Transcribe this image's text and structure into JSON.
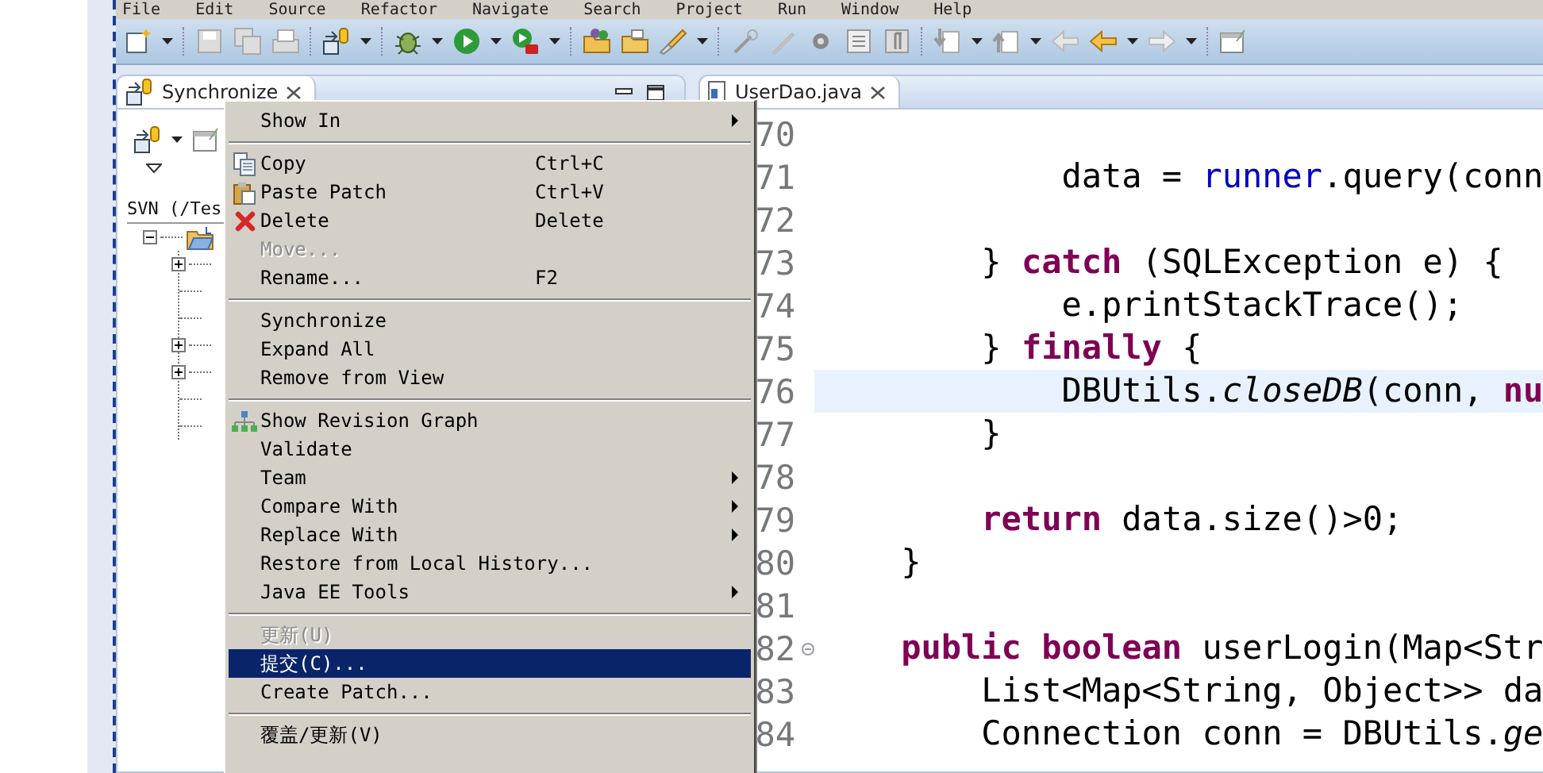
{
  "menu_bar": [
    "File",
    "Edit",
    "Source",
    "Refactor",
    "Navigate",
    "Search",
    "Project",
    "Run",
    "Window",
    "Help"
  ],
  "sync_view": {
    "tab": {
      "label": "Synchronize",
      "selected": true
    },
    "tree_header": "SVN (/Tes",
    "tree": [
      {
        "expanded": true,
        "children": [
          {
            "kind": "folder",
            "expanded": false
          },
          {
            "kind": "leaf"
          },
          {
            "kind": "leaf"
          },
          {
            "kind": "folder",
            "expanded": false
          },
          {
            "kind": "folder",
            "expanded": false
          },
          {
            "kind": "leaf"
          },
          {
            "kind": "leaf"
          }
        ]
      }
    ]
  },
  "editor": {
    "tab": {
      "label": "UserDao.java",
      "selected": true
    },
    "lines": [
      {
        "number": "70"
      },
      {
        "number": "71",
        "current": false,
        "code": [
          {
            "t": "            data = ",
            "kind": "plain"
          },
          {
            "t": "runner",
            "kind": "field"
          },
          {
            "t": ".query(conn",
            "kind": "plain"
          }
        ]
      },
      {
        "number": "72"
      },
      {
        "number": "73",
        "current": false,
        "code": [
          {
            "t": "        } ",
            "kind": "plain"
          },
          {
            "t": "catch",
            "kind": "keyword"
          },
          {
            "t": " (SQLException e) {",
            "kind": "plain"
          }
        ]
      },
      {
        "number": "74",
        "current": false,
        "code": [
          {
            "t": "            e.printStackTrace();",
            "kind": "plain"
          }
        ]
      },
      {
        "number": "75",
        "current": false,
        "code": [
          {
            "t": "        } ",
            "kind": "plain"
          },
          {
            "t": "finally",
            "kind": "keyword"
          },
          {
            "t": " {",
            "kind": "plain"
          }
        ]
      },
      {
        "number": "76",
        "current": true,
        "code": [
          {
            "t": "            DBUtils.",
            "kind": "plain"
          },
          {
            "t": "closeDB",
            "kind": "static"
          },
          {
            "t": "(conn, ",
            "kind": "plain"
          },
          {
            "t": "nu",
            "kind": "keyword"
          }
        ]
      },
      {
        "number": "77",
        "current": false,
        "code": [
          {
            "t": "        }",
            "kind": "plain"
          }
        ]
      },
      {
        "number": "78"
      },
      {
        "number": "79",
        "current": false,
        "code": [
          {
            "t": "        return",
            "kind": "keyword"
          },
          {
            "t": " data.size()>0;",
            "kind": "plain"
          }
        ]
      },
      {
        "number": "80",
        "current": false,
        "code": [
          {
            "t": "    }",
            "kind": "plain"
          }
        ]
      },
      {
        "number": "81"
      },
      {
        "number": "82",
        "current": false,
        "folded": false,
        "code": [
          {
            "t": "    public boolean",
            "kind": "keyword"
          },
          {
            "t": " userLogin(Map<Str",
            "kind": "plain"
          }
        ]
      },
      {
        "number": "83",
        "current": false,
        "code": [
          {
            "t": "        List<Map<String, Object>> da",
            "kind": "plain"
          }
        ]
      },
      {
        "number": "84",
        "current": false,
        "code": [
          {
            "t": "        Connection conn = DBUtils.",
            "kind": "plain"
          },
          {
            "t": "ge",
            "kind": "static"
          }
        ]
      }
    ]
  },
  "context_menu": [
    {
      "kind": "submenu",
      "label": "Show In",
      "disabled": false,
      "selected": false
    },
    {
      "kind": "separator"
    },
    {
      "kind": "copy",
      "label": "Copy",
      "shortcut": "Ctrl+C",
      "disabled": false,
      "selected": false
    },
    {
      "kind": "paste",
      "label": "Paste Patch",
      "shortcut": "Ctrl+V",
      "disabled": false,
      "selected": false
    },
    {
      "kind": "delete",
      "label": "Delete",
      "shortcut": "Delete",
      "disabled": false,
      "selected": false
    },
    {
      "kind": "plain",
      "label": "Move...",
      "disabled": true,
      "selected": false
    },
    {
      "kind": "plain",
      "label": "Rename...",
      "shortcut": "F2",
      "disabled": false,
      "selected": false
    },
    {
      "kind": "separator"
    },
    {
      "kind": "plain",
      "label": "Synchronize",
      "disabled": false,
      "selected": false
    },
    {
      "kind": "plain",
      "label": "Expand All",
      "disabled": false,
      "selected": false
    },
    {
      "kind": "plain",
      "label": "Remove from View",
      "disabled": false,
      "selected": false
    },
    {
      "kind": "separator"
    },
    {
      "kind": "graph",
      "label": "Show Revision Graph",
      "disabled": false,
      "selected": false
    },
    {
      "kind": "plain",
      "label": "Validate",
      "disabled": false,
      "selected": false
    },
    {
      "kind": "submenu",
      "label": "Team",
      "disabled": false,
      "selected": false
    },
    {
      "kind": "submenu",
      "label": "Compare With",
      "disabled": false,
      "selected": false
    },
    {
      "kind": "submenu",
      "label": "Replace With",
      "disabled": false,
      "selected": false
    },
    {
      "kind": "plain",
      "label": "Restore from Local History...",
      "disabled": false,
      "selected": false
    },
    {
      "kind": "submenu",
      "label": "Java EE Tools",
      "disabled": false,
      "selected": false
    },
    {
      "kind": "separator"
    },
    {
      "kind": "plain",
      "label": "更新(U)",
      "disabled": true,
      "selected": false
    },
    {
      "kind": "plain",
      "label": "提交(C)...",
      "disabled": false,
      "selected": true
    },
    {
      "kind": "plain",
      "label": "Create Patch...",
      "disabled": false,
      "selected": false
    },
    {
      "kind": "separator"
    },
    {
      "kind": "plain",
      "label": "覆盖/更新(V)",
      "disabled": false,
      "selected": false
    }
  ]
}
